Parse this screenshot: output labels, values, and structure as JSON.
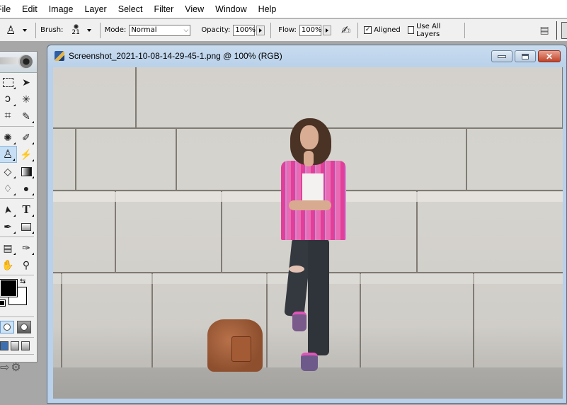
{
  "menu": {
    "items": [
      "File",
      "Edit",
      "Image",
      "Layer",
      "Select",
      "Filter",
      "View",
      "Window",
      "Help"
    ]
  },
  "options": {
    "tool_icon": "clone-stamp-icon",
    "brush_label": "Brush:",
    "brush_size": "21",
    "mode_label": "Mode:",
    "mode_value": "Normal",
    "opacity_label": "Opacity:",
    "opacity_value": "100%",
    "flow_label": "Flow:",
    "flow_value": "100%",
    "airbrush_icon": "airbrush-icon",
    "aligned_label": "Aligned",
    "aligned_checked": true,
    "use_all_layers_label": "Use All Layers",
    "use_all_layers_checked": false,
    "palette_icon": "file-browser-icon"
  },
  "toolbox": {
    "tools": [
      {
        "name": "rectangular-marquee",
        "glyph": "⬚"
      },
      {
        "name": "move",
        "glyph": "➤"
      },
      {
        "name": "lasso",
        "glyph": "ℓ"
      },
      {
        "name": "magic-wand",
        "glyph": "✳"
      },
      {
        "name": "crop",
        "glyph": "⌗"
      },
      {
        "name": "slice",
        "glyph": "✎"
      },
      {
        "name": "healing-brush",
        "glyph": "✺"
      },
      {
        "name": "brush",
        "glyph": "✐"
      },
      {
        "name": "clone-stamp",
        "glyph": "♙",
        "active": true
      },
      {
        "name": "history-brush",
        "glyph": "⚡"
      },
      {
        "name": "eraser",
        "glyph": "◇"
      },
      {
        "name": "gradient",
        "glyph": "▥"
      },
      {
        "name": "blur",
        "glyph": "💧"
      },
      {
        "name": "dodge",
        "glyph": "●"
      },
      {
        "name": "path-selection",
        "glyph": "➤"
      },
      {
        "name": "type",
        "glyph": "T"
      },
      {
        "name": "pen",
        "glyph": "✒"
      },
      {
        "name": "rectangle",
        "glyph": "▭"
      },
      {
        "name": "notes",
        "glyph": "📄"
      },
      {
        "name": "eyedropper",
        "glyph": "✑"
      },
      {
        "name": "hand",
        "glyph": "✋"
      },
      {
        "name": "zoom",
        "glyph": "🔍"
      }
    ],
    "foreground_color": "#000000",
    "background_color": "#ffffff"
  },
  "document": {
    "title": "Screenshot_2021-10-08-14-29-45-1.png @ 100% (RGB)",
    "close_glyph": "✕"
  },
  "colors": {
    "accent_active_tool": "#c7dff5",
    "window_frame": "#b9d1ea",
    "close_button": "#c0432a"
  }
}
